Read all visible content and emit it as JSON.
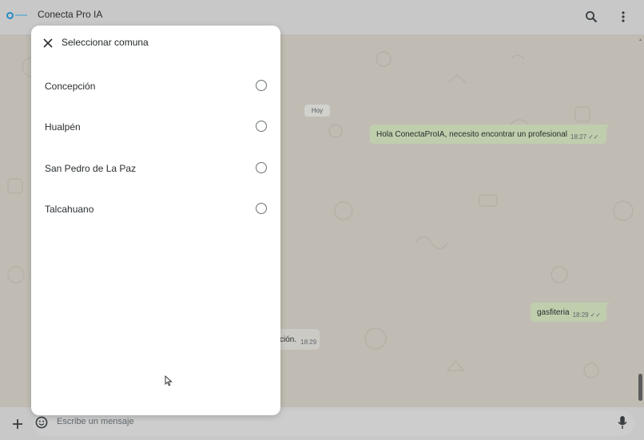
{
  "header": {
    "title": "Conecta Pro IA",
    "icons": {
      "search": "search-icon",
      "menu": "more-vert-icon"
    }
  },
  "chat": {
    "date_chip": "Hoy",
    "messages": [
      {
        "direction": "out",
        "text": "Hola ConectaProIA, necesito encontrar un profesional",
        "time": "18:27",
        "ticks": "✓✓"
      },
      {
        "direction": "out",
        "text": "gasfiteria",
        "time": "18:29",
        "ticks": "✓✓"
      },
      {
        "direction": "in",
        "text": "ción.",
        "time": "18:29"
      }
    ]
  },
  "composer": {
    "placeholder": "Escribe un mensaje",
    "icons": {
      "attach": "plus-icon",
      "emoji": "sticker-icon",
      "voice": "mic-icon"
    }
  },
  "dialog": {
    "title": "Seleccionar comuna",
    "options": [
      {
        "label": "Concepción",
        "selected": false
      },
      {
        "label": "Hualpén",
        "selected": false
      },
      {
        "label": "San Pedro de La Paz",
        "selected": false
      },
      {
        "label": "Talcahuano",
        "selected": false
      }
    ]
  },
  "colors": {
    "header_bg": "#d2d2d2",
    "chat_bg": "#c9c4ba",
    "outgoing_bubble": "#c8d8b3",
    "dialog_bg": "#ffffff",
    "brand": "#1f8fcf"
  }
}
